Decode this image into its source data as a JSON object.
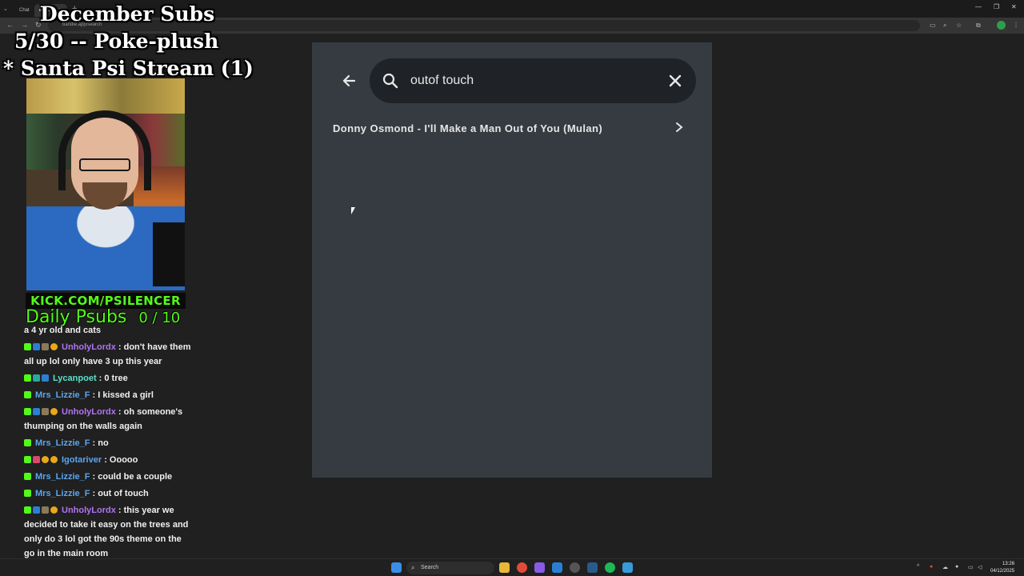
{
  "browser": {
    "tabs": [
      {
        "label": "Chat",
        "active": false
      },
      {
        "label": "Bandle",
        "active": true
      }
    ],
    "url": "bandle.app/search"
  },
  "overlay": {
    "title_line1": "December Subs",
    "title_line2": "5/30 -- Poke-plush",
    "title_line3": "* Santa Psi Stream (1)",
    "kick_link": "KICK.COM/PSILENCER",
    "daily_subs": "Daily Psubs",
    "daily_count": "0 / 10"
  },
  "search": {
    "query": "outof touch",
    "placeholder": "Search",
    "back_icon": "arrow-left-icon",
    "clear_icon": "close-icon"
  },
  "results": [
    {
      "title": "Donny Osmond - I'll Make a Man Out of You (Mulan)"
    }
  ],
  "chat": {
    "messages": [
      {
        "user": "",
        "text": "a 4 yr old and cats",
        "badges": [],
        "color": ""
      },
      {
        "user": "UnholyLordx",
        "text": " : don't have them all up lol only have 3 up this year",
        "badges": [
          "k",
          "p",
          "s",
          "c"
        ],
        "color": "purple"
      },
      {
        "user": "Lycanpoet",
        "text": " : 0 tree",
        "badges": [
          "k",
          "t",
          "p"
        ],
        "color": "green"
      },
      {
        "user": "Mrs_Lizzie_F",
        "text": " : I kissed a girl",
        "badges": [
          "k"
        ],
        "color": "blue"
      },
      {
        "user": "UnholyLordx",
        "text": " : oh someone's thumping on the walls again",
        "badges": [
          "k",
          "p",
          "s",
          "c"
        ],
        "color": "purple"
      },
      {
        "user": "Mrs_Lizzie_F",
        "text": " : no",
        "badges": [
          "k"
        ],
        "color": "blue"
      },
      {
        "user": "Igotariver",
        "text": " : Ooooo",
        "badges": [
          "k",
          "r",
          "c",
          "c"
        ],
        "color": "blue"
      },
      {
        "user": "Mrs_Lizzie_F",
        "text": " : could be a couple",
        "badges": [
          "k"
        ],
        "color": "blue"
      },
      {
        "user": "Mrs_Lizzie_F",
        "text": " : out of touch",
        "badges": [
          "k"
        ],
        "color": "blue"
      },
      {
        "user": "UnholyLordx",
        "text": " : this year we decided to take it easy on the trees and only do 3 lol got the 90s theme on the go in the main room",
        "badges": [
          "k",
          "p",
          "s",
          "c"
        ],
        "color": "purple"
      }
    ]
  },
  "taskbar": {
    "search_label": "Search",
    "time": "13:26",
    "date": "04/12/2025"
  }
}
